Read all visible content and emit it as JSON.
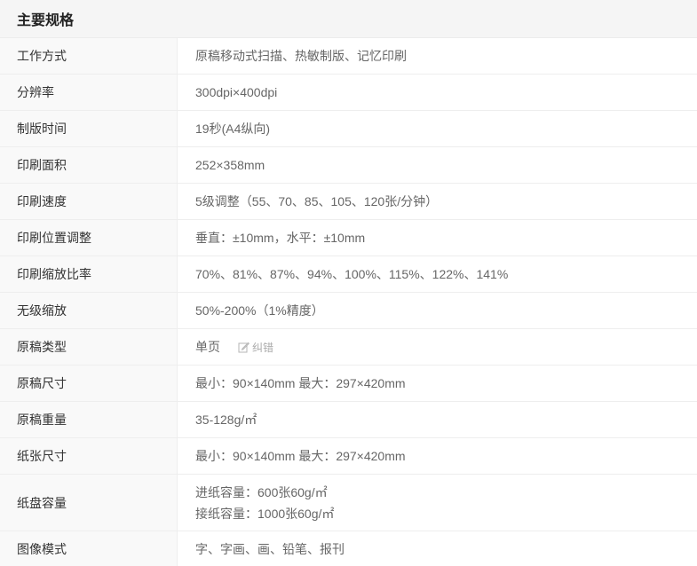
{
  "header": {
    "title": "主要规格"
  },
  "specs": [
    {
      "label": "工作方式",
      "lines": [
        "原稿移动式扫描、热敏制版、记忆印刷"
      ]
    },
    {
      "label": "分辨率",
      "lines": [
        "300dpi×400dpi"
      ]
    },
    {
      "label": "制版时间",
      "lines": [
        "19秒(A4纵向)"
      ]
    },
    {
      "label": "印刷面积",
      "lines": [
        "252×358mm"
      ]
    },
    {
      "label": "印刷速度",
      "lines": [
        "5级调整（55、70、85、105、120张/分钟）"
      ]
    },
    {
      "label": "印刷位置调整",
      "lines": [
        "垂直：±10mm，水平：±10mm"
      ]
    },
    {
      "label": "印刷缩放比率",
      "lines": [
        "70%、81%、87%、94%、100%、115%、122%、141%"
      ]
    },
    {
      "label": "无级缩放",
      "lines": [
        "50%-200%（1%精度）"
      ]
    },
    {
      "label": "原稿类型",
      "lines": [
        "单页"
      ],
      "correct_label": "纠错",
      "correct_icon": "edit-icon"
    },
    {
      "label": "原稿尺寸",
      "lines": [
        "最小：90×140mm 最大：297×420mm"
      ]
    },
    {
      "label": "原稿重量",
      "lines": [
        "35-128g/㎡"
      ]
    },
    {
      "label": "纸张尺寸",
      "lines": [
        "最小：90×140mm 最大：297×420mm"
      ]
    },
    {
      "label": "纸盘容量",
      "lines": [
        "进纸容量：600张60g/㎡",
        "接纸容量：1000张60g/㎡"
      ]
    },
    {
      "label": "图像模式",
      "lines": [
        "字、字画、画、铅笔、报刊"
      ]
    }
  ]
}
